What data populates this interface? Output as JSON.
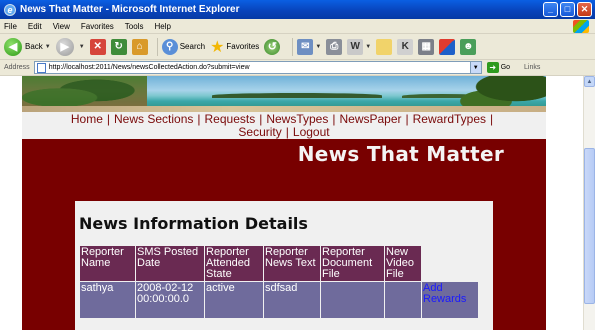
{
  "window": {
    "title": "News That Matter - Microsoft Internet Explorer",
    "minimize": "_",
    "maximize": "□",
    "close": "✕"
  },
  "menu": [
    "File",
    "Edit",
    "View",
    "Favorites",
    "Tools",
    "Help"
  ],
  "toolbar": {
    "back": "Back",
    "search": "Search",
    "favorites": "Favorites"
  },
  "address": {
    "label": "Address",
    "url": "http://localhost:2011/News/newsCollectedAction.do?submit=view",
    "go": "Go",
    "links": "Links"
  },
  "site": {
    "nav": [
      "Home",
      "News Sections",
      "Requests",
      "NewsTypes",
      "NewsPaper",
      "RewardTypes",
      "Security",
      "Logout"
    ],
    "separator": "|",
    "title": "News That Matter"
  },
  "panel": {
    "title": "News Information Details",
    "columns": [
      "Reporter Name",
      "SMS Posted Date",
      "Reporter Attended State",
      "Reporter News Text",
      "Reporter Document File",
      "New Video File"
    ],
    "rows": [
      [
        "sathya",
        "2008-02-12 00:00:00.0",
        "active",
        "sdfsad",
        "",
        ""
      ]
    ],
    "action_link": "Add Rewards"
  },
  "colors": {
    "site_background": "#780000",
    "header_cell": "#6a2a52",
    "data_cell": "#6f6b9c",
    "link": "#1a1aff"
  }
}
